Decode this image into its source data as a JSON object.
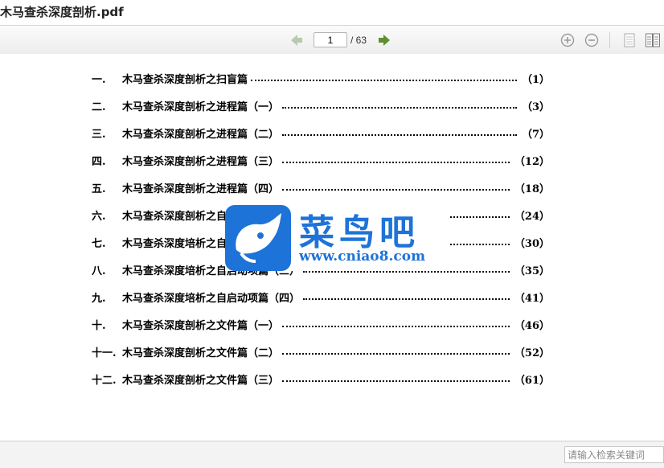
{
  "window": {
    "title": "木马查杀深度剖析.pdf"
  },
  "toolbar": {
    "current_page": "1",
    "page_count_label": "/ 63",
    "icons": [
      "arrow-left-icon",
      "arrow-right-icon",
      "zoom-in-icon",
      "zoom-out-icon",
      "single-page-icon",
      "two-page-icon"
    ],
    "colors": {
      "nav_arrow": "#6b9a3a",
      "zoom": "#9a9a9a"
    }
  },
  "toc": {
    "entries": [
      {
        "num": "一.",
        "title": "木马查杀深度剖析之扫盲篇",
        "page": "（1）"
      },
      {
        "num": "二.",
        "title": "木马查杀深度剖析之进程篇（一）",
        "page": "（3）"
      },
      {
        "num": "三.",
        "title": "木马查杀深度剖析之进程篇（二）",
        "page": "（7）"
      },
      {
        "num": "四.",
        "title": "木马查杀深度剖析之进程篇（三）",
        "page": "（12）"
      },
      {
        "num": "五.",
        "title": "木马查杀深度剖析之进程篇（四）",
        "page": "（18）"
      },
      {
        "num": "六.",
        "title": "木马查杀深度剖析之自启动项篇（一）",
        "page": "（24）"
      },
      {
        "num": "七.",
        "title": "木马查杀深度培析之自启动项篇（二）",
        "page": "（30）"
      },
      {
        "num": "八.",
        "title": "木马查杀深度培析之自启动项篇（三）",
        "page": "（35）"
      },
      {
        "num": "九.",
        "title": "木马查杀深度培析之自启动项篇（四）",
        "page": "（41）"
      },
      {
        "num": "十.",
        "title": "木马查杀深度剖析之文件篇（一）",
        "page": "（46）"
      },
      {
        "num": "十一.",
        "title": "木马查杀深度剖析之文件篇（二）",
        "page": "（52）"
      },
      {
        "num": "十二.",
        "title": "木马查杀深度剖析之文件篇（三）",
        "page": "（61）"
      }
    ]
  },
  "watermark": {
    "name": "菜鸟吧",
    "url": "www.cniao8.com",
    "color": "#1e73d8"
  },
  "search": {
    "placeholder": "请输入检索关键词"
  }
}
